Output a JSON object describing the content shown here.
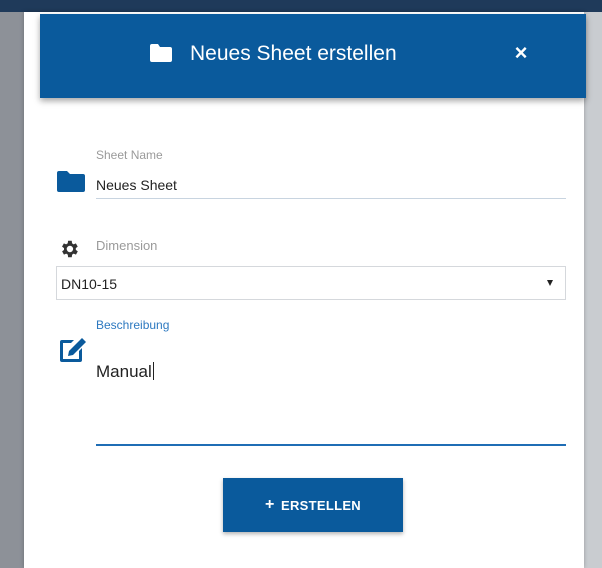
{
  "dialog": {
    "title": "Neues Sheet erstellen",
    "header_icon": "folder-icon",
    "close_label": "×"
  },
  "form": {
    "sheet_name": {
      "label": "Sheet Name",
      "value": "Neues Sheet",
      "icon": "folder-icon"
    },
    "dimension": {
      "label": "Dimension",
      "selected": "DN10-15",
      "icon": "gear-icon"
    },
    "description": {
      "label": "Beschreibung",
      "value": "Manual",
      "icon": "edit-icon"
    }
  },
  "submit": {
    "icon": "plus-icon",
    "plus": "+",
    "label": "ERSTELLEN"
  },
  "colors": {
    "primary": "#0a5a9c",
    "accent": "#2d79c0",
    "label_gray": "#9a9a9a"
  }
}
